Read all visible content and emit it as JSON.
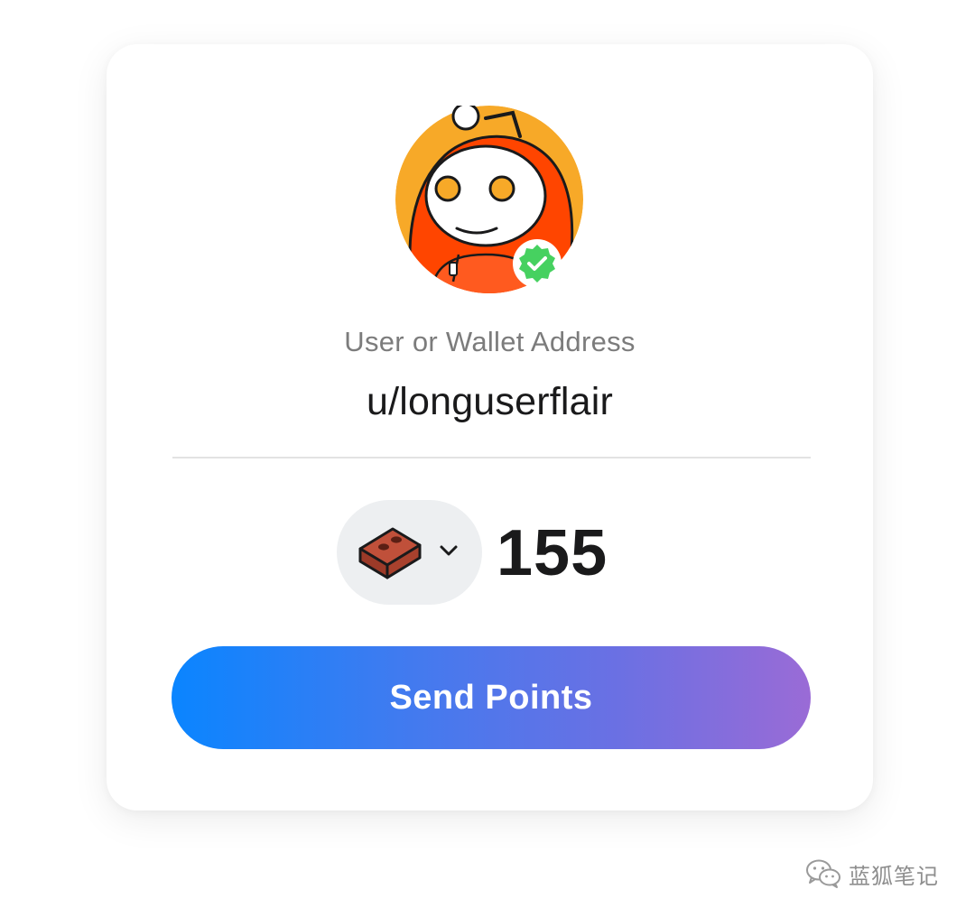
{
  "form": {
    "avatar_icon": "reddit-snoo-avatar-icon",
    "verified_icon": "verified-check-badge-icon",
    "address_label": "User or Wallet Address",
    "address_value": "u/longuserflair",
    "token_icon": "brick-icon",
    "token_dropdown_icon": "chevron-down-icon",
    "amount": "155",
    "send_label": "Send Points"
  },
  "watermark": {
    "icon": "wechat-icon",
    "text": "蓝狐笔记"
  },
  "colors": {
    "button_gradient_start": "#0a85ff",
    "button_gradient_end": "#9a6bd6",
    "avatar_bg": "#f7a928",
    "hoodie": "#ff4500",
    "verified": "#46d160",
    "token_pill_bg": "#edeff1"
  }
}
